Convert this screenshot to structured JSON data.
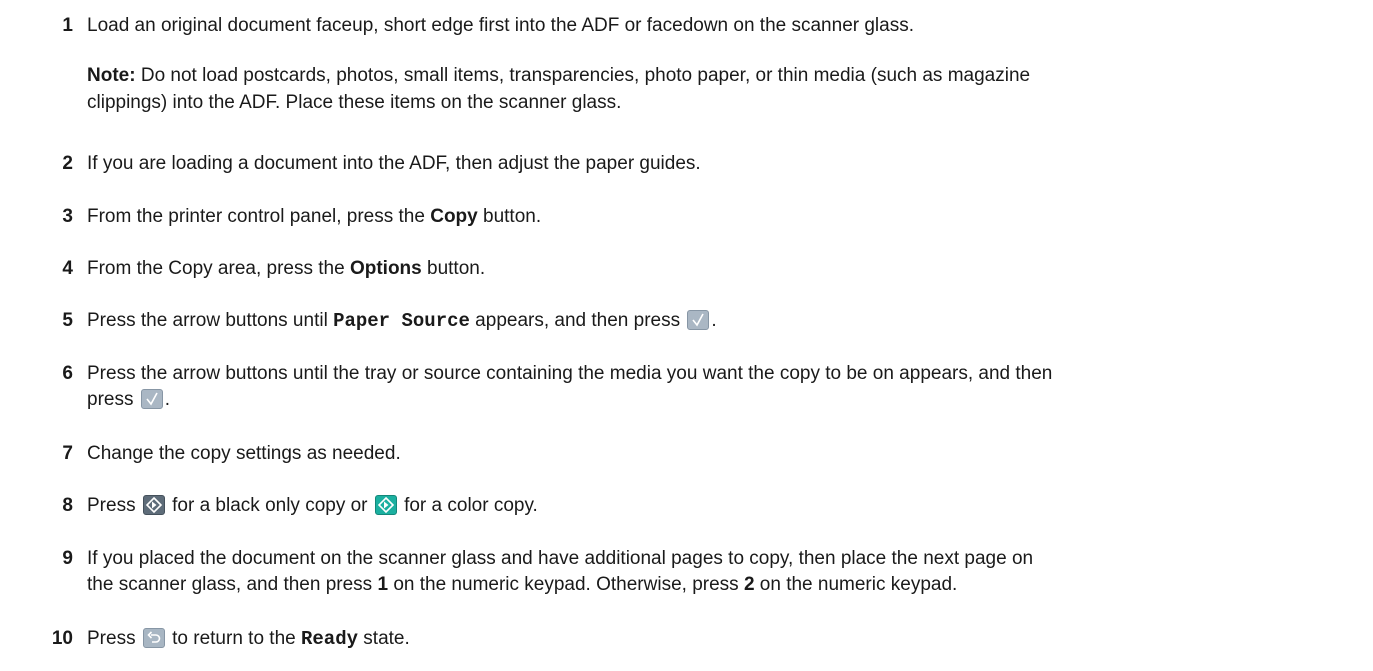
{
  "steps": {
    "s1": {
      "num": "1",
      "text": "Load an original document faceup, short edge first into the ADF or facedown on the scanner glass."
    },
    "note": {
      "label": "Note:",
      "line1": " Do not load postcards, photos, small items, transparencies, photo paper, or thin media (such as magazine",
      "line2": "clippings) into the ADF. Place these items on the scanner glass."
    },
    "s2": {
      "num": "2",
      "text": "If you are loading a document into the ADF, then adjust the paper guides."
    },
    "s3": {
      "num": "3",
      "pre": "From the printer control panel, press the ",
      "bold": "Copy",
      "post": " button."
    },
    "s4": {
      "num": "4",
      "pre": "From the Copy area, press the ",
      "bold": "Options",
      "post": " button."
    },
    "s5": {
      "num": "5",
      "pre": "Press the arrow buttons until ",
      "mono": "Paper Source",
      "post": " appears, and then press ",
      "end": "."
    },
    "s6": {
      "num": "6",
      "line1": "Press the arrow buttons until the tray or source containing the media you want the copy to be on appears, and then",
      "pre": "press ",
      "end": "."
    },
    "s7": {
      "num": "7",
      "text": "Change the copy settings as needed."
    },
    "s8": {
      "num": "8",
      "pre": "Press ",
      "mid": " for a black only copy or ",
      "post": " for a color copy."
    },
    "s9": {
      "num": "9",
      "line1": "If you placed the document on the scanner glass and have additional pages to copy, then place the next page on",
      "pre": "the scanner glass, and then press ",
      "key1": "1",
      "mid": " on the numeric keypad. Otherwise, press ",
      "key2": "2",
      "post": " on the numeric keypad."
    },
    "s10": {
      "num": "10",
      "pre": "Press ",
      "mid": " to return to the ",
      "mono": "Ready",
      "post": " state."
    }
  },
  "icons": {
    "check": "checkmark-button-icon",
    "black_start": "black-start-button-icon",
    "color_start": "color-start-button-icon",
    "back": "back-button-icon"
  },
  "colors": {
    "check_button": "#aab7c4",
    "black_start_button": "#5e6c79",
    "color_start_button": "#1bb0a0",
    "text": "#1a1a1a"
  }
}
